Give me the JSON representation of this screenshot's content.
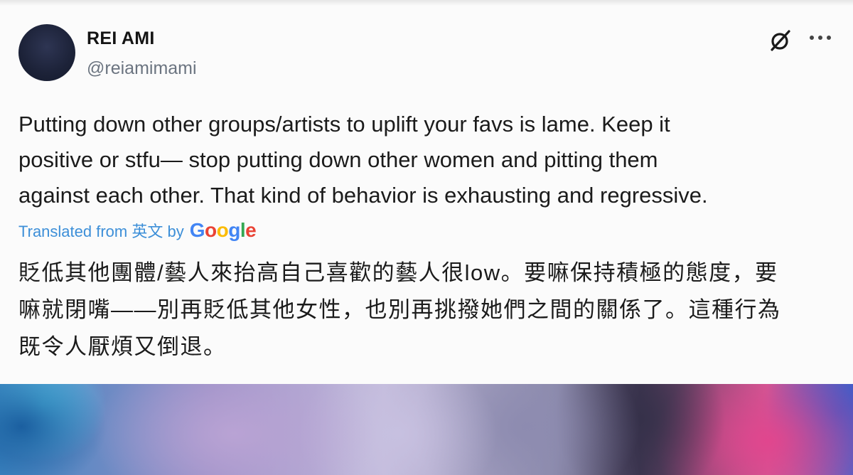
{
  "author": {
    "display_name": "REI AMI",
    "handle": "@reiamimami"
  },
  "icons": {
    "grok": "grok-slash-icon",
    "more": "more-options-icon"
  },
  "tweet": {
    "text": "Putting down other groups/artists to uplift your favs is lame. Keep it\npositive or stfu— stop putting down other women and pitting them\nagainst each other. That kind of behavior is exhausting and regressive."
  },
  "translation": {
    "label": "Translated from 英文 by",
    "provider": "Google",
    "text": "貶低其他團體/藝人來抬高自己喜歡的藝人很low。要嘛保持積極的態度，要\n嘛就閉嘴——別再貶低其他女性，也別再挑撥她們之間的關係了。這種行為\n既令人厭煩又倒退。"
  },
  "colors": {
    "link": "#3d8fd8",
    "text": "#1b1b1b",
    "handle": "#6b7480"
  }
}
